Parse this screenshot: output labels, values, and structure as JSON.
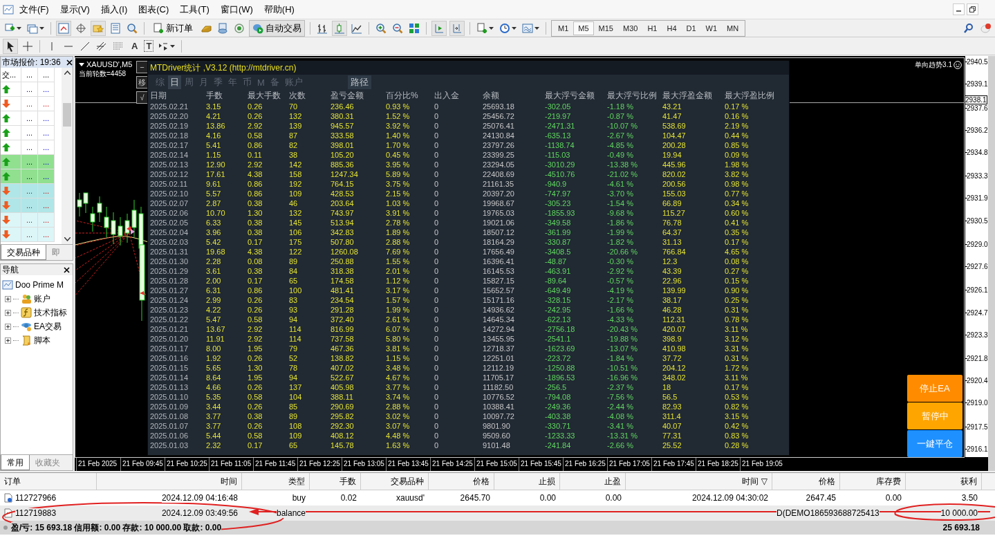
{
  "menu": [
    "文件(F)",
    "显示(V)",
    "插入(I)",
    "图表(C)",
    "工具(T)",
    "窗口(W)",
    "帮助(H)"
  ],
  "toolbar": {
    "new_order": "新订单",
    "auto_trading": {
      "label": "自动交易",
      "on": true
    },
    "timeframes": [
      {
        "label": "M1",
        "selected": false
      },
      {
        "label": "M5",
        "selected": true
      },
      {
        "label": "M15",
        "selected": false
      },
      {
        "label": "M30",
        "selected": false
      },
      {
        "label": "H1",
        "selected": false
      },
      {
        "label": "H4",
        "selected": false
      },
      {
        "label": "D1",
        "selected": false
      },
      {
        "label": "W1",
        "selected": false
      },
      {
        "label": "MN",
        "selected": false
      }
    ],
    "text_tool": "A",
    "label_tool": "T"
  },
  "market_watch": {
    "title": "市场报价: 19:36",
    "columns": [
      "交...",
      "...",
      "..."
    ],
    "rows": [
      {
        "rising": true,
        "bid": "...",
        "ask": "...",
        "color": "#ffffff"
      },
      {
        "rising": false,
        "bid": "...",
        "ask": "...",
        "color": "#ffffff"
      },
      {
        "rising": true,
        "bid": "...",
        "ask": "...",
        "color": "#ffffff"
      },
      {
        "rising": true,
        "bid": "...",
        "ask": "...",
        "color": "#ffffff"
      },
      {
        "rising": true,
        "bid": "...",
        "ask": "...",
        "color": "#ffffff"
      },
      {
        "rising": true,
        "bid": "...",
        "ask": "...",
        "color": "#90e090"
      },
      {
        "rising": true,
        "bid": "...",
        "ask": "...",
        "color": "#90e090"
      },
      {
        "rising": false,
        "bid": "...",
        "ask": "...",
        "color": "#b0e6e8"
      },
      {
        "rising": false,
        "bid": "...",
        "ask": "...",
        "color": "#b0e6e8"
      },
      {
        "rising": false,
        "bid": "...",
        "ask": "...",
        "color": "#dcf6f8"
      },
      {
        "rising": false,
        "bid": "...",
        "ask": "...",
        "color": "#dcf6f8"
      }
    ],
    "tabs": [
      {
        "label": "交易品种",
        "selected": true
      },
      {
        "label": "即",
        "selected": false
      }
    ]
  },
  "navigator": {
    "title": "导航",
    "root": "Doo Prime M",
    "children": [
      {
        "label": "账户",
        "kind": "accounts",
        "expanded": false
      },
      {
        "label": "技术指标",
        "kind": "indicators",
        "expanded": false
      },
      {
        "label": "EA交易",
        "kind": "experts",
        "expanded": false
      },
      {
        "label": "脚本",
        "kind": "scripts",
        "expanded": false
      }
    ],
    "tabs": [
      {
        "label": "常用",
        "selected": true
      },
      {
        "label": "收藏夹",
        "selected": false
      }
    ]
  },
  "chart": {
    "symbol": "XAUUSD',M5",
    "round_info": "当前轮数=4458",
    "indicator": "单向趋势3.1",
    "side_buttons": [
      "−",
      "移",
      "√"
    ],
    "price_labels": [
      {
        "label": "2940.5",
        "current": false
      },
      {
        "label": "2939.1",
        "current": false
      },
      {
        "label": "2938.1",
        "current": true
      },
      {
        "label": "2937.6",
        "current": false
      },
      {
        "label": "2936.2",
        "current": false
      },
      {
        "label": "2934.8",
        "current": false
      },
      {
        "label": "2933.3",
        "current": false
      },
      {
        "label": "2931.9",
        "current": false
      },
      {
        "label": "2930.5",
        "current": false
      },
      {
        "label": "2929.0",
        "current": false
      },
      {
        "label": "2927.6",
        "current": false
      },
      {
        "label": "2926.1",
        "current": false
      },
      {
        "label": "2924.7",
        "current": false
      },
      {
        "label": "2923.3",
        "current": false
      },
      {
        "label": "2921.8",
        "current": false
      },
      {
        "label": "2920.4",
        "current": false
      },
      {
        "label": "2919.0",
        "current": false
      },
      {
        "label": "2917.5",
        "current": false
      },
      {
        "label": "2916.1",
        "current": false
      }
    ],
    "time_labels": [
      "21 Feb 2025",
      "21 Feb 09:45",
      "21 Feb 10:25",
      "21 Feb 11:05",
      "21 Feb 11:45",
      "21 Feb 12:25",
      "21 Feb 13:05",
      "21 Feb 13:45",
      "21 Feb 14:25",
      "21 Feb 15:05",
      "21 Feb 15:45",
      "21 Feb 16:25",
      "21 Feb 17:05",
      "21 Feb 17:45",
      "21 Feb 18:25",
      "21 Feb 19:05"
    ],
    "action_buttons": [
      {
        "label": "停止EA",
        "color": "#ff8c00"
      },
      {
        "label": "暂停中",
        "color": "#ffa500"
      },
      {
        "label": "一鍵平仓",
        "color": "#1e90ff"
      }
    ]
  },
  "stats": {
    "title": "MTDriver统计 ,V3.12 (http://mtdriver.cn)",
    "tabs": [
      {
        "label": "综",
        "selected": false
      },
      {
        "label": "日",
        "selected": true
      },
      {
        "label": "周",
        "selected": false
      },
      {
        "label": "月",
        "selected": false
      },
      {
        "label": "季",
        "selected": false
      },
      {
        "label": "年",
        "selected": false
      },
      {
        "label": "币",
        "selected": false
      },
      {
        "label": "M",
        "selected": false
      },
      {
        "label": "备",
        "selected": false
      },
      {
        "label": "账户",
        "selected": false
      }
    ],
    "path_button": "路径",
    "columns": [
      {
        "label": "日期",
        "kind": "date"
      },
      {
        "label": "手数",
        "kind": "value"
      },
      {
        "label": "最大手数",
        "kind": "value"
      },
      {
        "label": "次数",
        "kind": "value"
      },
      {
        "label": "盈亏金额",
        "kind": "value"
      },
      {
        "label": "百分比%",
        "kind": "value"
      },
      {
        "label": "出入金",
        "kind": "flow"
      },
      {
        "label": "余额",
        "kind": "flow"
      },
      {
        "label": "最大浮亏金额",
        "kind": "loss"
      },
      {
        "label": "最大浮亏比例",
        "kind": "loss"
      },
      {
        "label": "最大浮盈金额",
        "kind": "value"
      },
      {
        "label": "最大浮盈比例",
        "kind": "value"
      }
    ],
    "rows": [
      [
        "2025.02.21",
        "3.15",
        "0.26",
        "70",
        "236.46",
        "0.93 %",
        "0",
        "25693.18",
        "-302.05",
        "-1.18 %",
        "43.21",
        "0.17 %"
      ],
      [
        "2025.02.20",
        "4.21",
        "0.26",
        "132",
        "380.31",
        "1.52 %",
        "0",
        "25456.72",
        "-219.97",
        "-0.87 %",
        "41.47",
        "0.16 %"
      ],
      [
        "2025.02.19",
        "13.86",
        "2.92",
        "139",
        "945.57",
        "3.92 %",
        "0",
        "25076.41",
        "-2471.31",
        "-10.07 %",
        "538.69",
        "2.19 %"
      ],
      [
        "2025.02.18",
        "4.16",
        "0.58",
        "87",
        "333.58",
        "1.40 %",
        "0",
        "24130.84",
        "-635.13",
        "-2.67 %",
        "104.47",
        "0.44 %"
      ],
      [
        "2025.02.17",
        "5.41",
        "0.86",
        "82",
        "398.01",
        "1.70 %",
        "0",
        "23797.26",
        "-1138.74",
        "-4.85 %",
        "200.28",
        "0.85 %"
      ],
      [
        "2025.02.14",
        "1.15",
        "0.11",
        "38",
        "105.20",
        "0.45 %",
        "0",
        "23399.25",
        "-115.03",
        "-0.49 %",
        "19.94",
        "0.09 %"
      ],
      [
        "2025.02.13",
        "12.90",
        "2.92",
        "142",
        "885.36",
        "3.95 %",
        "0",
        "23294.05",
        "-3010.29",
        "-13.38 %",
        "445.96",
        "1.98 %"
      ],
      [
        "2025.02.12",
        "17.61",
        "4.38",
        "158",
        "1247.34",
        "5.89 %",
        "0",
        "22408.69",
        "-4510.76",
        "-21.02 %",
        "820.02",
        "3.82 %"
      ],
      [
        "2025.02.11",
        "9.61",
        "0.86",
        "192",
        "764.15",
        "3.75 %",
        "0",
        "21161.35",
        "-940.9",
        "-4.61 %",
        "200.56",
        "0.98 %"
      ],
      [
        "2025.02.10",
        "5.57",
        "0.86",
        "109",
        "428.53",
        "2.15 %",
        "0",
        "20397.20",
        "-747.97",
        "-3.70 %",
        "155.03",
        "0.77 %"
      ],
      [
        "2025.02.07",
        "2.87",
        "0.38",
        "46",
        "203.64",
        "1.03 %",
        "0",
        "19968.67",
        "-305.23",
        "-1.54 %",
        "66.89",
        "0.34 %"
      ],
      [
        "2025.02.06",
        "10.70",
        "1.30",
        "132",
        "743.97",
        "3.91 %",
        "0",
        "19765.03",
        "-1855.93",
        "-9.68 %",
        "115.27",
        "0.60 %"
      ],
      [
        "2025.02.05",
        "6.33",
        "0.38",
        "145",
        "513.94",
        "2.78 %",
        "0",
        "19021.06",
        "-349.58",
        "-1.86 %",
        "76.78",
        "0.41 %"
      ],
      [
        "2025.02.04",
        "3.96",
        "0.38",
        "106",
        "342.83",
        "1.89 %",
        "0",
        "18507.12",
        "-361.99",
        "-1.99 %",
        "64.37",
        "0.35 %"
      ],
      [
        "2025.02.03",
        "5.42",
        "0.17",
        "175",
        "507.80",
        "2.88 %",
        "0",
        "18164.29",
        "-330.87",
        "-1.82 %",
        "31.13",
        "0.17 %"
      ],
      [
        "2025.01.31",
        "19.68",
        "4.38",
        "122",
        "1260.08",
        "7.69 %",
        "0",
        "17656.49",
        "-3408.5",
        "-20.66 %",
        "766.84",
        "4.65 %"
      ],
      [
        "2025.01.30",
        "2.28",
        "0.08",
        "89",
        "250.88",
        "1.55 %",
        "0",
        "16396.41",
        "-48.87",
        "-0.30 %",
        "12.3",
        "0.08 %"
      ],
      [
        "2025.01.29",
        "3.61",
        "0.38",
        "84",
        "318.38",
        "2.01 %",
        "0",
        "16145.53",
        "-463.91",
        "-2.92 %",
        "43.39",
        "0.27 %"
      ],
      [
        "2025.01.28",
        "2.00",
        "0.17",
        "65",
        "174.58",
        "1.12 %",
        "0",
        "15827.15",
        "-89.64",
        "-0.57 %",
        "22.96",
        "0.15 %"
      ],
      [
        "2025.01.27",
        "6.31",
        "0.86",
        "100",
        "481.41",
        "3.17 %",
        "0",
        "15652.57",
        "-649.49",
        "-4.19 %",
        "139.99",
        "0.90 %"
      ],
      [
        "2025.01.24",
        "2.99",
        "0.26",
        "83",
        "234.54",
        "1.57 %",
        "0",
        "15171.16",
        "-328.15",
        "-2.17 %",
        "38.17",
        "0.25 %"
      ],
      [
        "2025.01.23",
        "4.22",
        "0.26",
        "93",
        "291.28",
        "1.99 %",
        "0",
        "14936.62",
        "-242.95",
        "-1.66 %",
        "46.28",
        "0.31 %"
      ],
      [
        "2025.01.22",
        "5.47",
        "0.58",
        "94",
        "372.40",
        "2.61 %",
        "0",
        "14645.34",
        "-622.13",
        "-4.33 %",
        "112.31",
        "0.78 %"
      ],
      [
        "2025.01.21",
        "13.67",
        "2.92",
        "114",
        "816.99",
        "6.07 %",
        "0",
        "14272.94",
        "-2756.18",
        "-20.43 %",
        "420.07",
        "3.11 %"
      ],
      [
        "2025.01.20",
        "11.91",
        "2.92",
        "114",
        "737.58",
        "5.80 %",
        "0",
        "13455.95",
        "-2541.1",
        "-19.88 %",
        "398.9",
        "3.12 %"
      ],
      [
        "2025.01.17",
        "8.00",
        "1.95",
        "79",
        "467.36",
        "3.81 %",
        "0",
        "12718.37",
        "-1623.69",
        "-13.07 %",
        "410.98",
        "3.31 %"
      ],
      [
        "2025.01.16",
        "1.92",
        "0.26",
        "52",
        "138.82",
        "1.15 %",
        "0",
        "12251.01",
        "-223.72",
        "-1.84 %",
        "37.72",
        "0.31 %"
      ],
      [
        "2025.01.15",
        "5.65",
        "1.30",
        "78",
        "407.02",
        "3.48 %",
        "0",
        "12112.19",
        "-1250.88",
        "-10.51 %",
        "204.12",
        "1.72 %"
      ],
      [
        "2025.01.14",
        "8.64",
        "1.95",
        "94",
        "522.67",
        "4.67 %",
        "0",
        "11705.17",
        "-1896.53",
        "-16.96 %",
        "348.02",
        "3.11 %"
      ],
      [
        "2025.01.13",
        "4.66",
        "0.26",
        "137",
        "405.98",
        "3.77 %",
        "0",
        "11182.50",
        "-256.5",
        "-2.37 %",
        "18",
        "0.17 %"
      ],
      [
        "2025.01.10",
        "5.35",
        "0.58",
        "104",
        "388.11",
        "3.74 %",
        "0",
        "10776.52",
        "-794.08",
        "-7.56 %",
        "56.5",
        "0.53 %"
      ],
      [
        "2025.01.09",
        "3.44",
        "0.26",
        "85",
        "290.69",
        "2.88 %",
        "0",
        "10388.41",
        "-249.36",
        "-2.44 %",
        "82.93",
        "0.82 %"
      ],
      [
        "2025.01.08",
        "3.77",
        "0.38",
        "89",
        "295.82",
        "3.02 %",
        "0",
        "10097.72",
        "-403.38",
        "-4.08 %",
        "311.4",
        "3.15 %"
      ],
      [
        "2025.01.07",
        "3.77",
        "0.26",
        "108",
        "292.30",
        "3.07 %",
        "0",
        "9801.90",
        "-330.71",
        "-3.41 %",
        "40.07",
        "0.42 %"
      ],
      [
        "2025.01.06",
        "5.44",
        "0.58",
        "109",
        "408.12",
        "4.48 %",
        "0",
        "9509.60",
        "-1233.33",
        "-13.31 %",
        "77.31",
        "0.83 %"
      ],
      [
        "2025.01.03",
        "2.32",
        "0.17",
        "65",
        "145.78",
        "1.63 %",
        "0",
        "9101.48",
        "-241.84",
        "-2.66 %",
        "25.52",
        "0.28 %"
      ]
    ]
  },
  "terminal": {
    "columns": [
      "订单",
      "时间",
      "类型",
      "手数",
      "交易品种",
      "价格",
      "止损",
      "止盈",
      "时间 ▽",
      "价格",
      "库存费",
      "获利"
    ],
    "rows": [
      {
        "kind": "trade",
        "cells": [
          "112727966",
          "2024.12.09 04:16:48",
          "buy",
          "0.02",
          "xauusd'",
          "2645.70",
          "0.00",
          "0.00",
          "2024.12.09 04:30:02",
          "2647.45",
          "0.00",
          "3.50"
        ]
      },
      {
        "kind": "balance",
        "cells": [
          "112719883",
          "2024.12.09 03:49:56",
          "balance",
          "",
          "",
          "",
          "",
          "",
          "",
          "D(DEMO186593688725413",
          "",
          "10 000.00"
        ]
      }
    ],
    "summary": "盈/亏: 15 693.18  信用额: 0.00  存款: 10 000.00  取款: 0.00",
    "total": "25 693.18"
  },
  "annotations": [
    {
      "kind": "ellipse"
    },
    {
      "kind": "arrow"
    },
    {
      "kind": "ellipse-right"
    }
  ]
}
